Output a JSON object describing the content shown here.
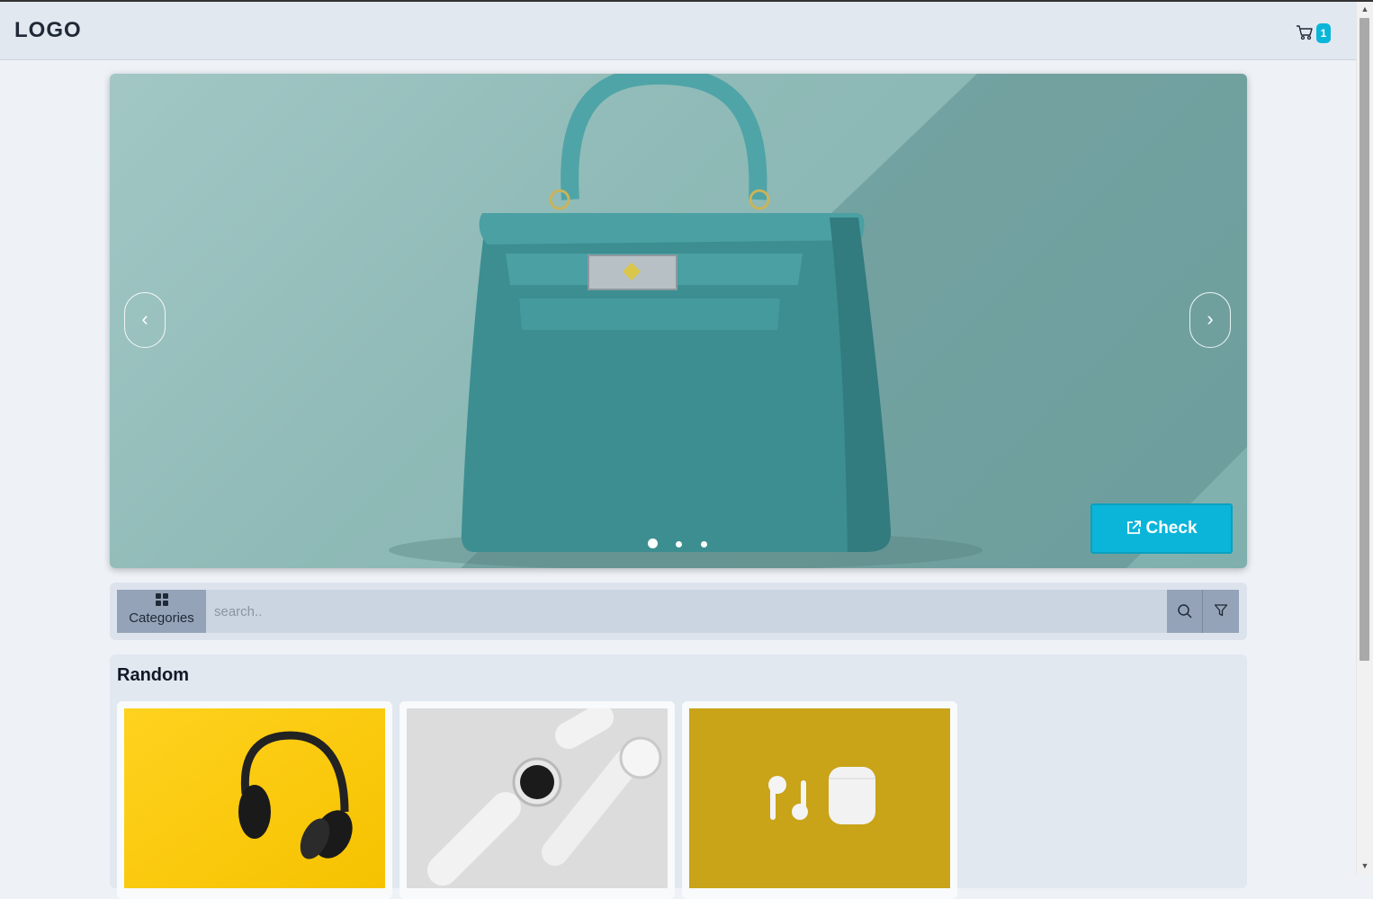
{
  "header": {
    "logo": "LOGO",
    "cart_count": "1"
  },
  "carousel": {
    "active_slide": 1,
    "slide_count": 3,
    "cta_label": "Check"
  },
  "search": {
    "categories_label": "Categories",
    "placeholder": "search.."
  },
  "random_section": {
    "title": "Random",
    "products": [
      {
        "image": "headphones-on-yellow"
      },
      {
        "image": "smartwatch-on-grey"
      },
      {
        "image": "earbuds-on-mustard"
      }
    ]
  },
  "colors": {
    "accent": "#0bb5d9",
    "navbar": "#e2e8f0",
    "button_grey": "#94a3b8"
  }
}
